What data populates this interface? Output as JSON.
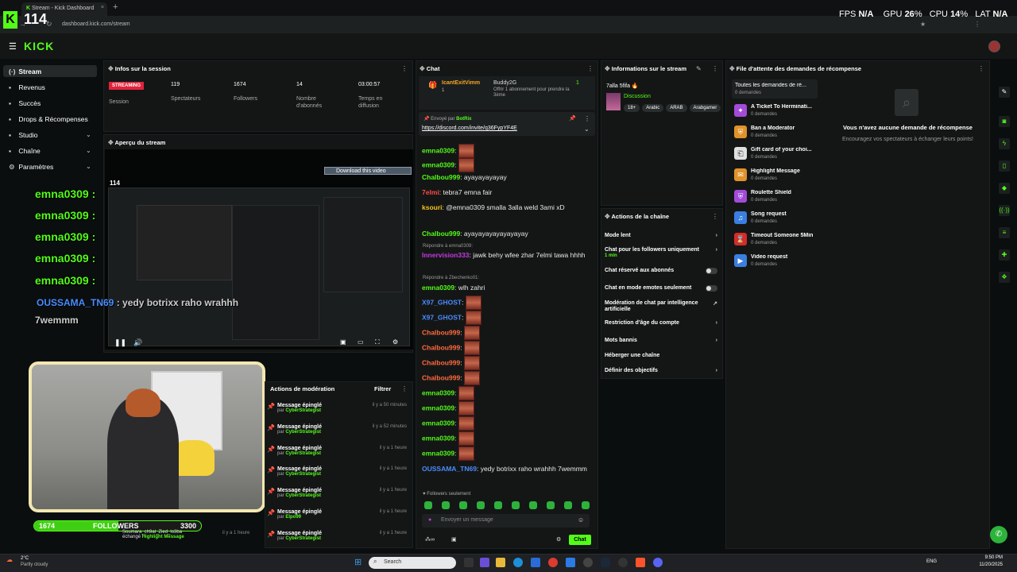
{
  "browser": {
    "tab_title": "Stream - Kick Dashboard",
    "url": "dashboard.kick.com/stream",
    "new_tab": "+",
    "close": "×"
  },
  "overlay": {
    "fps_big": "114",
    "stats": {
      "fps_label": "FPS",
      "fps_value": "N/A",
      "gpu_label": "GPU",
      "gpu_value": "26",
      "cpu_label": "CPU",
      "cpu_value": "14",
      "lat_label": "LAT",
      "lat_value": "N/A",
      "pct": "%"
    }
  },
  "header": {
    "logo": "KICK"
  },
  "sidebar": {
    "items": [
      {
        "label": "Stream",
        "icon": "(·)"
      },
      {
        "label": "Revenus",
        "icon": "▪"
      },
      {
        "label": "Succès",
        "icon": "▪"
      },
      {
        "label": "Drops & Récompenses",
        "icon": "▪"
      },
      {
        "label": "Studio",
        "icon": "▪"
      },
      {
        "label": "Chaîne",
        "icon": "▪"
      },
      {
        "label": "Paramètres",
        "icon": "⚙"
      }
    ]
  },
  "session": {
    "title": "Infos sur la session",
    "badge": "STREAMING",
    "session_label": "Session",
    "spectators_value": "119",
    "spectators_label": "Spectateurs",
    "followers_value": "1674",
    "followers_label": "Followers",
    "subs_value": "14",
    "subs_label1": "Nombre",
    "subs_label2": "d'abonnés",
    "time_value": "03:00:57",
    "time_label1": "Temps en",
    "time_label2": "diffusion"
  },
  "preview": {
    "title": "Aperçu du stream",
    "download_btn": "Download this video",
    "mini_count": "114"
  },
  "stream_overlay": {
    "chat_user": "emna0309 :",
    "msg_user": "OUSSAMA_TN69",
    "msg_text": " : yedy botrixx raho wrahhh",
    "msg_text2": "7wemmm",
    "followers_count": "1674",
    "followers_label": "FOLLOWERS",
    "followers_goal": "3300",
    "followers_progress": 0.507,
    "cam_overlay_user": "Soumara_ch9al_Zied_lo3ba",
    "cam_overlay_text": "échangé",
    "cam_overlay_reward": "Highlight Message",
    "cam_overlay_time": "il y a 1 heure"
  },
  "moderation": {
    "title": "Actions de modération",
    "filter": "Filtrer",
    "items": [
      {
        "title": "Message épinglé",
        "by": "par",
        "user": "CyberStrategist",
        "time": "il y a 50 minutes"
      },
      {
        "title": "Message épinglé",
        "by": "par",
        "user": "CyberStrategist",
        "time": "il y a 52 minutes"
      },
      {
        "title": "Message épinglé",
        "by": "par",
        "user": "CyberStrategist",
        "time": "il y a 1 heure"
      },
      {
        "title": "Message épinglé",
        "by": "par",
        "user": "CyberStrategist",
        "time": "il y a 1 heure"
      },
      {
        "title": "Message épinglé",
        "by": "par",
        "user": "CyberStrategist",
        "time": "il y a 1 heure"
      },
      {
        "title": "Message épinglé",
        "by": "par",
        "user": "Elpo99",
        "time": "il y a 1 heure"
      },
      {
        "title": "Message épinglé",
        "by": "par",
        "user": "CyberStrategist",
        "time": "il y a 1 heure"
      }
    ]
  },
  "chat": {
    "title": "Chat",
    "gift_user": "IcantExitVimm",
    "gift_count": "1",
    "gift_to": "Buddy2G",
    "gift_text": "Offrir 1 abonnement pour prendre la 3ème",
    "pinned_by": "Envoyé par",
    "pinned_user": "BotRix",
    "pinned_link": "https://discord.com/invite/q36FypYF4E",
    "messages": [
      {
        "user": "emna0309",
        "color": "#53fc18",
        "text": "",
        "emote": true
      },
      {
        "user": "emna0309",
        "color": "#53fc18",
        "text": "",
        "emote": true
      },
      {
        "user": "Chalbou999",
        "color": "#53fc18",
        "text": "ayayayayayay",
        "emote": false
      },
      {
        "user": "7elmi",
        "color": "#ff4a4a",
        "text": "tebra7 emna fair",
        "emote": false
      },
      {
        "user": "ksouri",
        "color": "#f5c518",
        "text": "@emna0309 smalla 3alla weld 3ami xD",
        "emote": false
      },
      {
        "user": "Chalbou999",
        "color": "#53fc18",
        "text": "ayayayayayayayayay",
        "emote": false
      }
    ],
    "reply1": "Répondre à emna0309:",
    "msg_innervision_user": "Innervision333",
    "msg_innervision_text": "jawk behy wfee zhar 7elmi tawa hhhh",
    "reply2": "Répondre à Zbechenko01:",
    "msg_wlh_user": "emna0309",
    "msg_wlh_text": "wlh zahri",
    "emote_lines": [
      {
        "user": "X97_GHOST",
        "color": "#4a8cff"
      },
      {
        "user": "X97_GHOST",
        "color": "#4a8cff"
      },
      {
        "user": "Chalbou999",
        "color": "#ff6a3d"
      },
      {
        "user": "Chalbou999",
        "color": "#ff6a3d"
      },
      {
        "user": "Chalbou999",
        "color": "#ff6a3d"
      },
      {
        "user": "Chalbou999",
        "color": "#ff6a3d"
      },
      {
        "user": "emna0309",
        "color": "#53fc18"
      },
      {
        "user": "emna0309",
        "color": "#53fc18"
      },
      {
        "user": "emna0309",
        "color": "#53fc18"
      },
      {
        "user": "emna0309",
        "color": "#53fc18"
      },
      {
        "user": "emna0309",
        "color": "#53fc18"
      }
    ],
    "last_user": "OUSSAMA_TN69",
    "last_text": "yedy botrixx raho wrahhh 7wemmm",
    "followers_only": "Followers seulement",
    "input_placeholder": "Envoyer un message",
    "send_btn": "Chat"
  },
  "stream_info": {
    "title": "Informations sur le stream",
    "stream_title": "7alla 5fifa",
    "category": "Discussion",
    "tags": [
      "18+",
      "Arabic",
      "ARAB",
      "Arabgamer"
    ]
  },
  "channel_actions": {
    "title": "Actions de la chaîne",
    "items": [
      {
        "label": "Mode lent",
        "type": "arrow"
      },
      {
        "label": "Chat pour les followers uniquement",
        "sub": "1 min",
        "type": "arrow"
      },
      {
        "label": "Chat réservé aux abonnés",
        "type": "toggle"
      },
      {
        "label": "Chat en mode emotes seulement",
        "type": "toggle"
      },
      {
        "label": "Modération de chat par intelligence artificielle",
        "type": "ext"
      },
      {
        "label": "Restriction d'âge du compte",
        "type": "arrow"
      },
      {
        "label": "Mots bannis",
        "type": "arrow"
      },
      {
        "label": "Héberger une chaîne",
        "type": "none"
      },
      {
        "label": "Définir des objectifs",
        "type": "arrow"
      }
    ]
  },
  "rewards": {
    "title": "File d'attente des demandes de récompense",
    "all_label": "Toutes les demandes de ré...",
    "all_count": "0 demandes",
    "empty_title": "Vous n'avez aucune demande de récompense",
    "empty_text": "Encouragez vos spectateurs à échanger leurs points!",
    "items": [
      {
        "label": "A Ticket To Herminati...",
        "count": "0 demandes",
        "color": "#a24bd8"
      },
      {
        "label": "Ban a Moderator",
        "count": "0 demandes",
        "color": "#e0932a"
      },
      {
        "label": "Gift card of your choi...",
        "count": "0 demandes",
        "color": "#e0e0e0"
      },
      {
        "label": "Highlight Message",
        "count": "0 demandes",
        "color": "#e0932a"
      },
      {
        "label": "Roulette Shield",
        "count": "0 demandes",
        "color": "#a24bd8"
      },
      {
        "label": "Song request",
        "count": "0 demandes",
        "color": "#3a7ee0"
      },
      {
        "label": "Timeout Someone 5Min",
        "count": "0 demandes",
        "color": "#d42b2b"
      },
      {
        "label": "Video request",
        "count": "0 demandes",
        "color": "#3a7ee0"
      }
    ]
  },
  "taskbar": {
    "weather_temp": "2°C",
    "weather_desc": "Partly cloudy",
    "search": "Search",
    "lang": "ENG",
    "time": "9:50 PM",
    "date": "11/20/2025"
  }
}
